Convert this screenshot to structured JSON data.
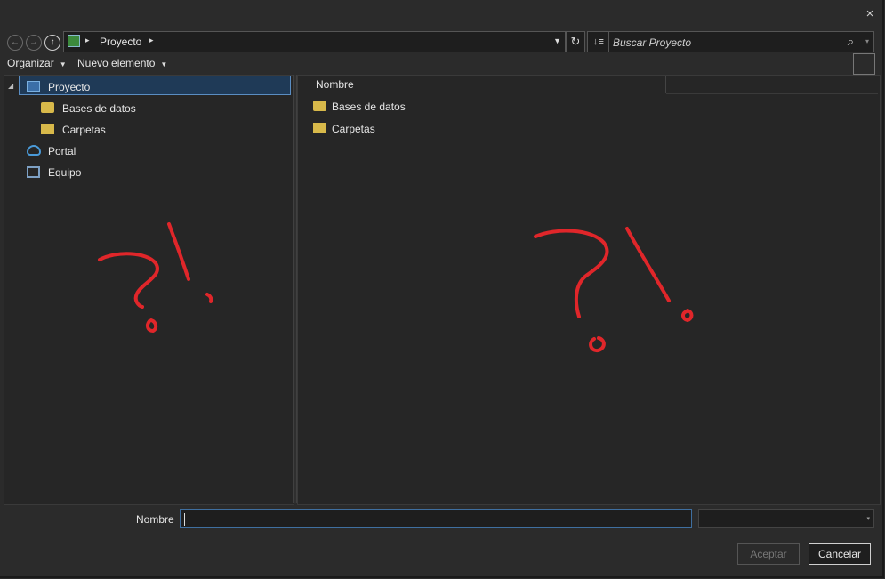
{
  "window": {
    "close_icon": "×"
  },
  "nav": {
    "back": "←",
    "forward": "→",
    "up": "↑"
  },
  "address": {
    "path": "Proyecto",
    "sep": "▸",
    "drop": "▼",
    "refresh": "↻"
  },
  "search": {
    "sort": "↓≡",
    "placeholder": "Buscar Proyecto",
    "icon": "⌕",
    "drop": "▾"
  },
  "toolbar": {
    "organize": "Organizar",
    "new_item": "Nuevo elemento",
    "arrow": "▼"
  },
  "tree": {
    "expander": "◢",
    "items": [
      {
        "label": "Proyecto",
        "icon": "project-icon"
      },
      {
        "label": "Bases de datos",
        "icon": "database-folder-icon"
      },
      {
        "label": "Carpetas",
        "icon": "folder-icon"
      },
      {
        "label": "Portal",
        "icon": "cloud-icon"
      },
      {
        "label": "Equipo",
        "icon": "computer-icon"
      }
    ]
  },
  "list": {
    "column": "Nombre",
    "items": [
      {
        "label": "Bases de datos",
        "icon": "database-folder-icon"
      },
      {
        "label": "Carpetas",
        "icon": "folder-icon"
      }
    ]
  },
  "footer": {
    "name_label": "Nombre",
    "name_value": "",
    "accept": "Aceptar",
    "cancel": "Cancelar",
    "filter_drop": "▾"
  },
  "colors": {
    "selection": "#1f3a57",
    "ink": "#e0262a",
    "background": "#2b2b2b"
  }
}
